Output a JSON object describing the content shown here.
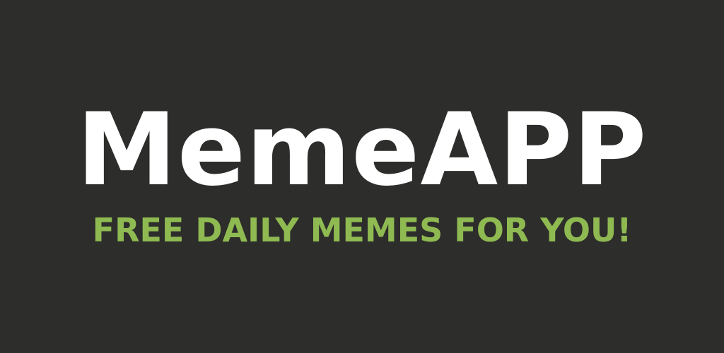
{
  "banner": {
    "app_name": "MemeAPP",
    "tagline": "FREE DAILY MEMES FOR YOU!"
  },
  "colors": {
    "background": "#2d2d2b",
    "app_name": "#ffffff",
    "tagline": "#8fba52"
  }
}
